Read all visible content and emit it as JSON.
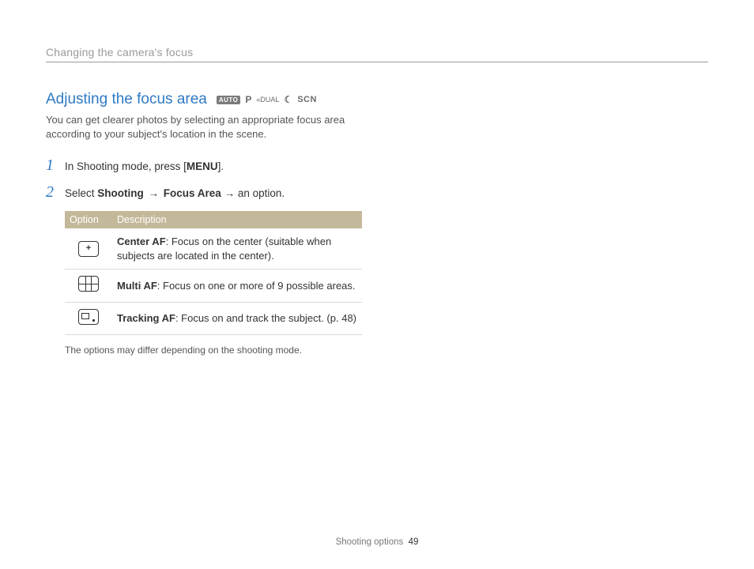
{
  "breadcrumb": "Changing the camera's focus",
  "heading": "Adjusting the focus area",
  "modes": {
    "auto": "AUTO",
    "p": "P",
    "dual": "DUAL",
    "night": "☾",
    "scn": "SCN"
  },
  "intro": "You can get clearer photos by selecting an appropriate focus area according to your subject's location in the scene.",
  "steps": [
    {
      "num": "1",
      "pre": "In Shooting mode, press [",
      "bold1": "MENU",
      "post": "]."
    },
    {
      "num": "2",
      "pre": "Select ",
      "bold1": "Shooting",
      "mid1": " → ",
      "bold2": "Focus Area",
      "mid2": " → an option."
    }
  ],
  "table": {
    "headers": {
      "option": "Option",
      "description": "Description"
    },
    "rows": [
      {
        "bold": "Center AF",
        "rest": ": Focus on the center (suitable when subjects are located in the center)."
      },
      {
        "bold": "Multi AF",
        "rest": ": Focus on one or more of 9 possible areas."
      },
      {
        "bold": "Tracking AF",
        "rest": ": Focus on and track the subject. (p. 48)"
      }
    ]
  },
  "table_note": "The options may differ depending on the shooting mode.",
  "footer": {
    "section": "Shooting options",
    "page": "49"
  }
}
